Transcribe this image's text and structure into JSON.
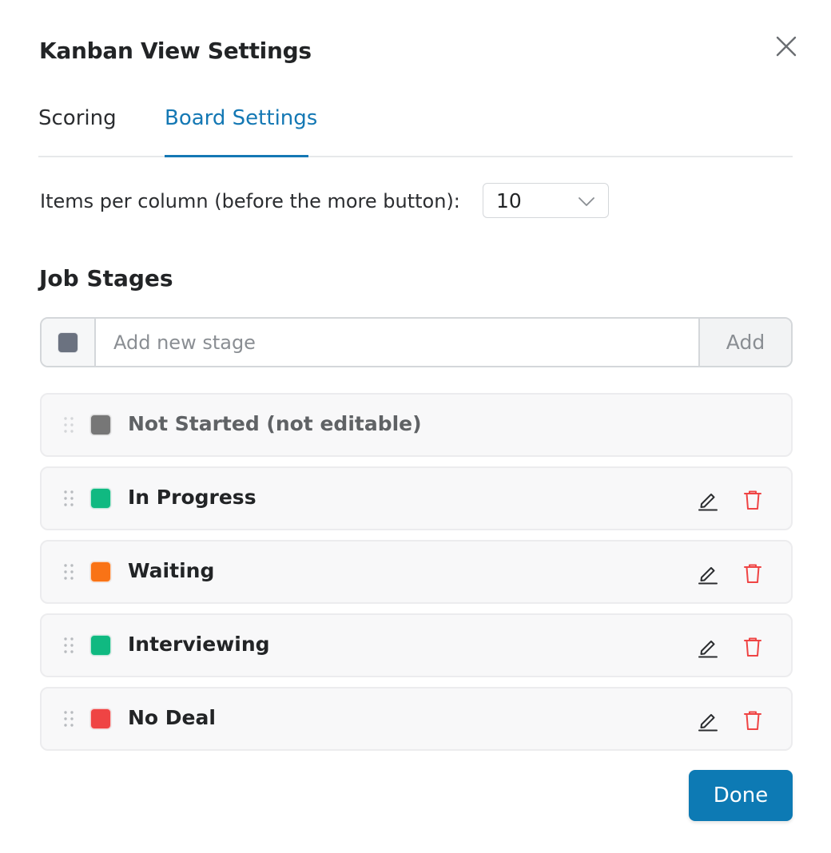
{
  "dialog": {
    "title": "Kanban View Settings",
    "close_icon": "close-icon"
  },
  "tabs": [
    {
      "label": "Scoring",
      "active": false
    },
    {
      "label": "Board Settings",
      "active": true
    }
  ],
  "board_settings": {
    "items_per_column_label": "Items per column (before the more button):",
    "items_per_column_value": "10"
  },
  "job_stages": {
    "title": "Job Stages",
    "add_placeholder": "Add new stage",
    "add_color": "#6b7280",
    "add_button_label": "Add",
    "stages": [
      {
        "label": "Not Started (not editable)",
        "color": "#777777",
        "editable": false
      },
      {
        "label": "In Progress",
        "color": "#10b981",
        "editable": true
      },
      {
        "label": "Waiting",
        "color": "#f97316",
        "editable": true
      },
      {
        "label": "Interviewing",
        "color": "#10b981",
        "editable": true
      },
      {
        "label": "No Deal",
        "color": "#ef4444",
        "editable": true
      }
    ]
  },
  "footer": {
    "done_label": "Done"
  },
  "colors": {
    "accent": "#1478b4",
    "primary_button": "#0d7ab4",
    "delete": "#ef4444"
  }
}
